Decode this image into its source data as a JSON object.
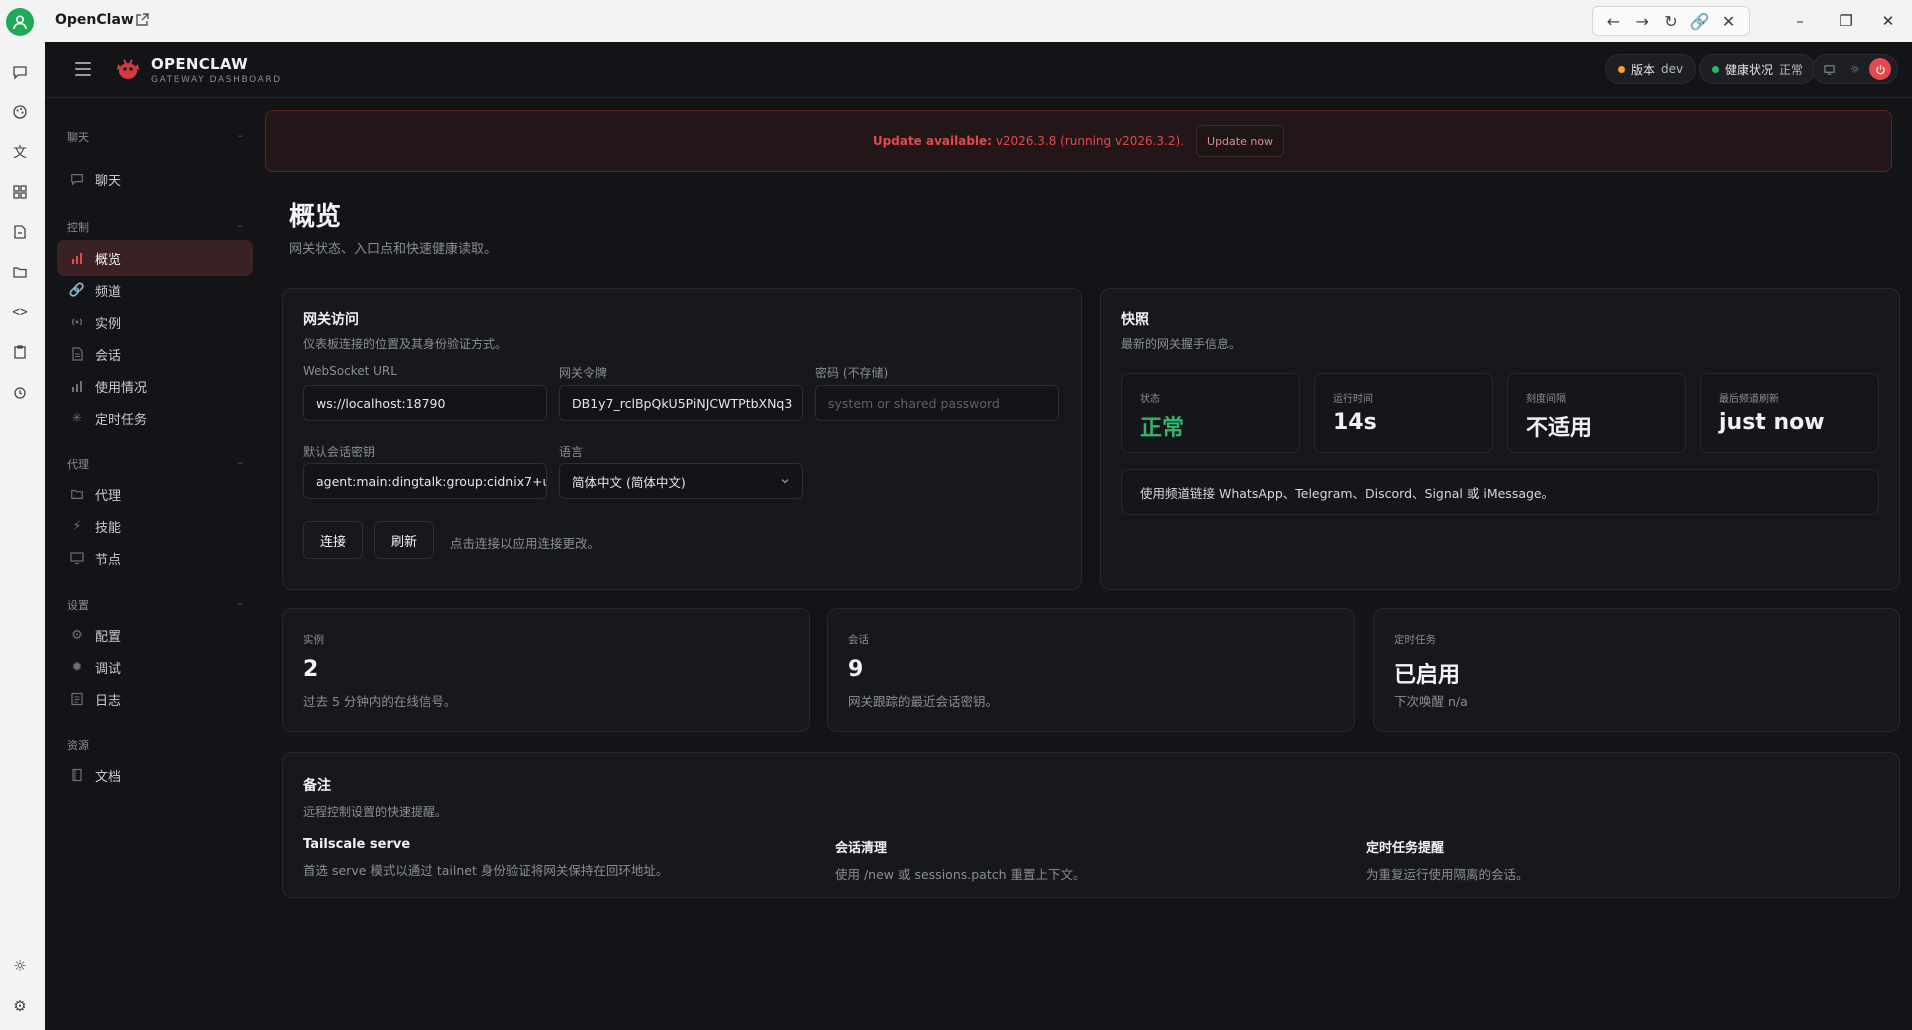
{
  "window": {
    "title": "OpenClaw",
    "nav_icons": [
      "back-icon",
      "forward-icon",
      "reload-icon",
      "link-icon",
      "close-icon"
    ],
    "controls": [
      "minimize-icon",
      "restore-icon",
      "close-icon"
    ]
  },
  "rail": {
    "icons": [
      "chat-icon",
      "palette-icon",
      "translate-icon",
      "grid-icon",
      "file-sync-icon",
      "folder-icon",
      "code-icon",
      "clipboard-icon",
      "alarm-icon"
    ],
    "bottom_icons": [
      "sun-icon",
      "settings-icon"
    ]
  },
  "header": {
    "brand": "OPENCLAW",
    "brand_sub": "GATEWAY DASHBOARD",
    "version_label": "版本",
    "version_value": "dev",
    "health_label": "健康状况",
    "health_value": "正常",
    "colors": {
      "version_dot": "#f5a623",
      "health_dot": "#2fb66b",
      "accent": "#e5484d"
    }
  },
  "sidebar": {
    "sections": [
      {
        "title": "聊天",
        "items": [
          {
            "label": "聊天",
            "icon": "chat-icon"
          }
        ]
      },
      {
        "title": "控制",
        "items": [
          {
            "label": "概览",
            "icon": "bar-chart-icon",
            "active": true
          },
          {
            "label": "频道",
            "icon": "link-icon"
          },
          {
            "label": "实例",
            "icon": "broadcast-icon"
          },
          {
            "label": "会话",
            "icon": "document-icon"
          },
          {
            "label": "使用情况",
            "icon": "bar-chart-icon"
          },
          {
            "label": "定时任务",
            "icon": "loader-icon"
          }
        ]
      },
      {
        "title": "代理",
        "items": [
          {
            "label": "代理",
            "icon": "folder-icon"
          },
          {
            "label": "技能",
            "icon": "lightning-icon"
          },
          {
            "label": "节点",
            "icon": "monitor-icon"
          }
        ]
      },
      {
        "title": "设置",
        "items": [
          {
            "label": "配置",
            "icon": "settings-icon"
          },
          {
            "label": "调试",
            "icon": "bug-icon"
          },
          {
            "label": "日志",
            "icon": "log-icon"
          }
        ]
      },
      {
        "title": "资源",
        "items": [
          {
            "label": "文档",
            "icon": "book-icon"
          }
        ]
      }
    ]
  },
  "banner": {
    "strong": "Update available:",
    "text": "v2026.3.8 (running v2026.3.2).",
    "button": "Update now"
  },
  "page": {
    "title": "概览",
    "subtitle": "网关状态、入口点和快速健康读取。"
  },
  "gateway": {
    "title": "网关访问",
    "subtitle": "仪表板连接的位置及其身份验证方式。",
    "ws_label": "WebSocket URL",
    "ws_value": "ws://localhost:18790",
    "token_label": "网关令牌",
    "token_value": "DB1y7_rclBpQkU5PiNJCWTPtbXNq3",
    "password_label": "密码 (不存储)",
    "password_placeholder": "system or shared password",
    "session_label": "默认会话密钥",
    "session_value": "agent:main:dingtalk:group:cidnix7+u",
    "language_label": "语言",
    "language_value": "简体中文 (简体中文)",
    "connect": "连接",
    "refresh": "刷新",
    "hint": "点击连接以应用连接更改。"
  },
  "snapshot": {
    "title": "快照",
    "subtitle": "最新的网关握手信息。",
    "stats": [
      {
        "label": "状态",
        "value": "正常"
      },
      {
        "label": "运行时间",
        "value": "14s"
      },
      {
        "label": "刻度间隔",
        "value": "不适用"
      },
      {
        "label": "最后频道刷新",
        "value": "just now"
      }
    ],
    "info": "使用频道链接 WhatsApp、Telegram、Discord、Signal 或 iMessage。"
  },
  "metrics": [
    {
      "label": "实例",
      "value": "2",
      "sub": "过去 5 分钟内的在线信号。"
    },
    {
      "label": "会话",
      "value": "9",
      "sub": "网关跟踪的最近会话密钥。"
    },
    {
      "label": "定时任务",
      "value": "已启用",
      "sub": "下次唤醒 n/a"
    }
  ],
  "notes": {
    "title": "备注",
    "subtitle": "远程控制设置的快速提醒。",
    "items": [
      {
        "title": "Tailscale serve",
        "desc": "首选 serve 模式以通过 tailnet 身份验证将网关保持在回环地址。"
      },
      {
        "title": "会话清理",
        "desc": "使用 /new 或 sessions.patch 重置上下文。"
      },
      {
        "title": "定时任务提醒",
        "desc": "为重复运行使用隔离的会话。"
      }
    ]
  }
}
